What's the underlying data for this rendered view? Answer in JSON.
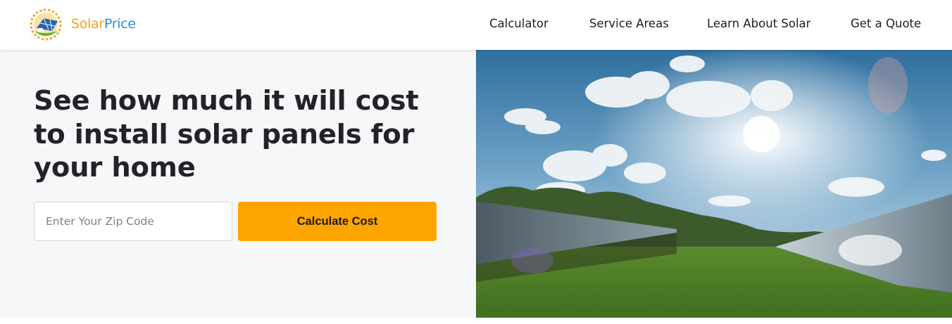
{
  "brand": {
    "part1": "Solar",
    "part2": "Price",
    "color_solar": "#f5a511",
    "color_price": "#2a8fd8"
  },
  "nav": {
    "items": [
      {
        "label": "Calculator"
      },
      {
        "label": "Service Areas"
      },
      {
        "label": "Learn About Solar"
      },
      {
        "label": "Get a Quote"
      }
    ]
  },
  "hero": {
    "title": "See how much it will cost to install solar panels for your home",
    "zip_placeholder": "Enter Your Zip Code",
    "button_label": "Calculate Cost",
    "accent_color": "#ffa500",
    "image_subject": "solar panel field under sunny sky"
  },
  "icons": {
    "logo": "solar-house-logo-icon"
  }
}
